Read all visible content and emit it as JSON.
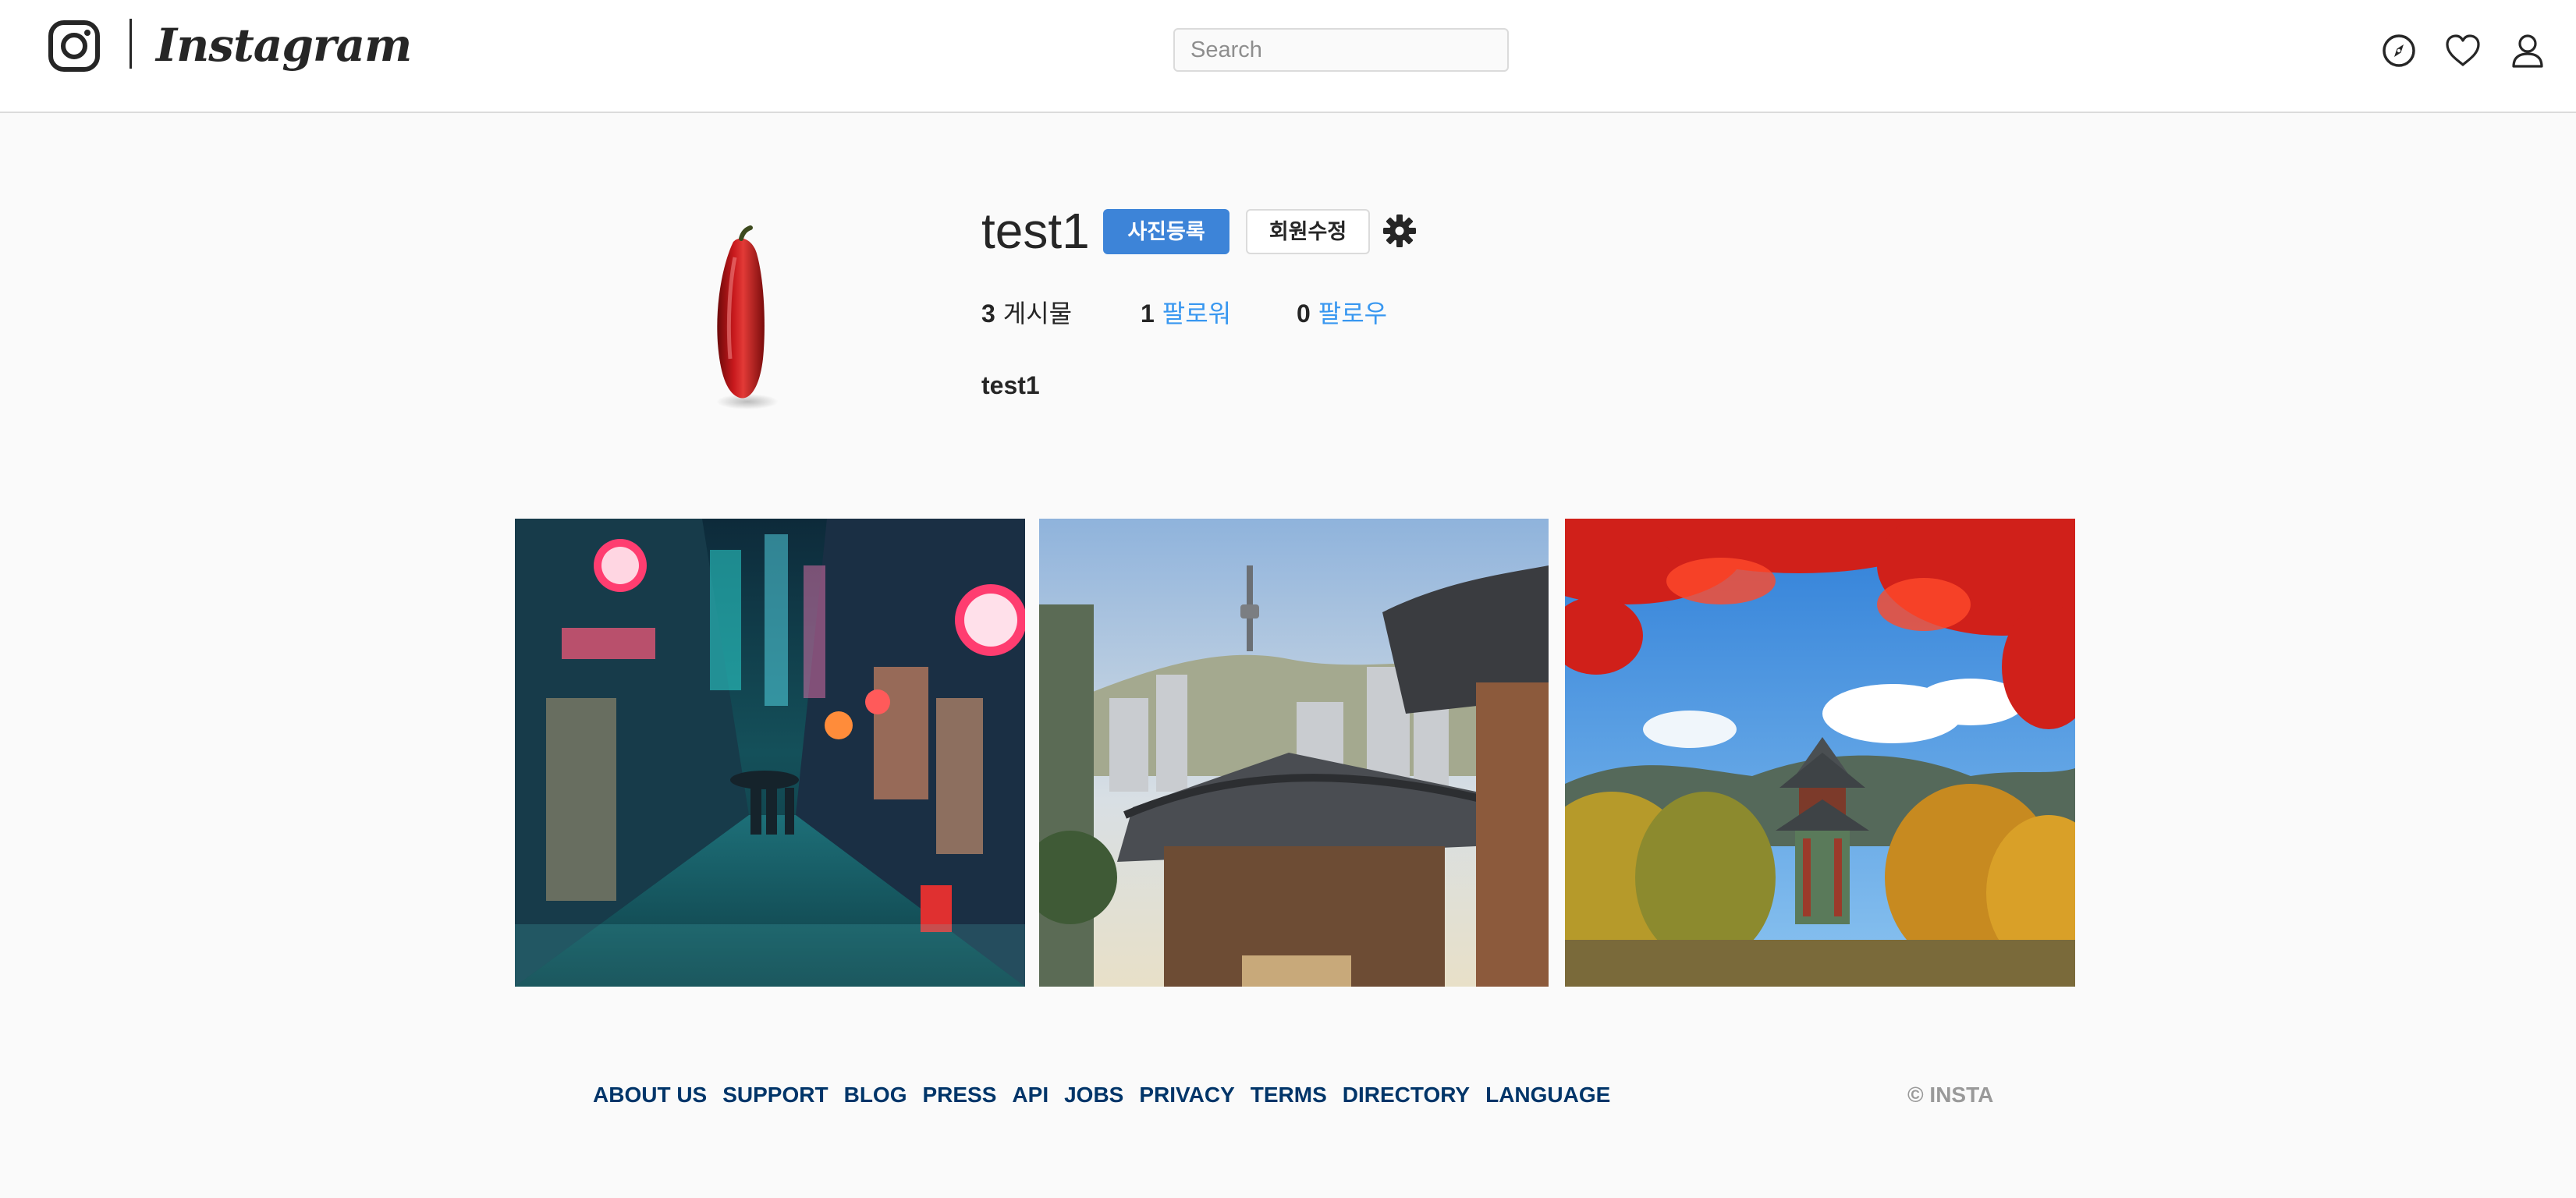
{
  "header": {
    "logo_text": "Instagram",
    "search_placeholder": "Search",
    "icons": [
      "instagram-glyph-icon",
      "explore-compass-icon",
      "heart-icon",
      "profile-user-icon"
    ]
  },
  "profile": {
    "username": "test1",
    "upload_button": "사진등록",
    "edit_button": "회원수정",
    "settings_icon": "gear-icon",
    "stats": {
      "posts": {
        "count": "3",
        "label": "게시물"
      },
      "followers": {
        "count": "1",
        "label": "팔로워"
      },
      "following": {
        "count": "0",
        "label": "팔로우"
      }
    },
    "bio_name": "test1"
  },
  "photos": [
    {
      "subject": "neon-alley-night-rain"
    },
    {
      "subject": "hanok-rooftops-and-seoul-tower"
    },
    {
      "subject": "palace-pavilion-autumn-maple"
    }
  ],
  "footer": {
    "links": [
      "ABOUT US",
      "SUPPORT",
      "BLOG",
      "PRESS",
      "API",
      "JOBS",
      "PRIVACY",
      "TERMS",
      "DIRECTORY",
      "LANGUAGE"
    ],
    "copyright": "© INSTA"
  },
  "colors": {
    "accent": "#3d84d8",
    "link": "#3897f0",
    "footer_link": "#003569",
    "background": "#fafafa"
  }
}
